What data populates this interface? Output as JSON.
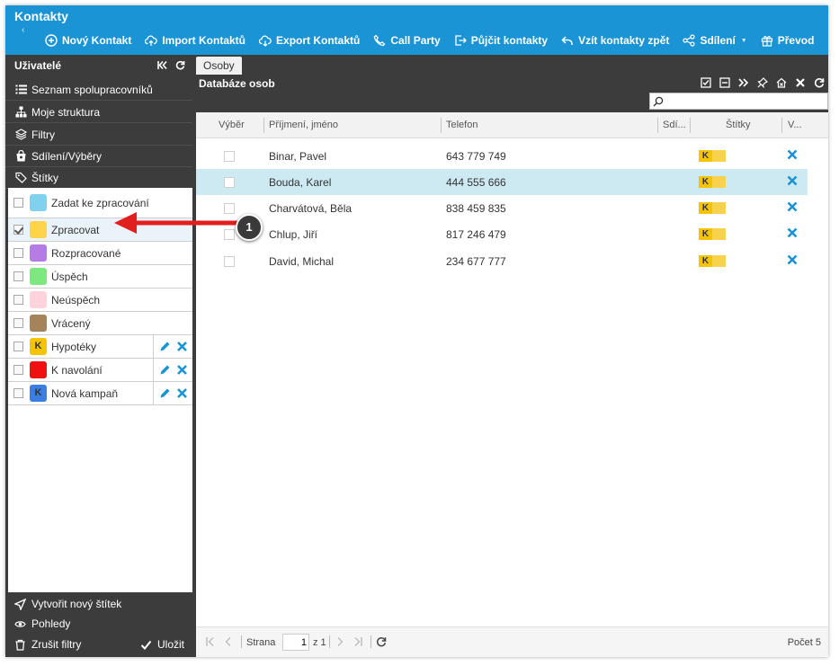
{
  "app": {
    "title": "Kontakty"
  },
  "colors": {
    "appbar": "#1a94d4",
    "sidebar": "#3c3c3c",
    "selected_row": "#cdeaf3",
    "delete_icon": "#1a94d4",
    "callout_arrow": "#e21f1f"
  },
  "toolbar": [
    {
      "label": "Nový Kontakt",
      "icon": "plus-circle-icon"
    },
    {
      "label": "Import Kontaktů",
      "icon": "cloud-upload-icon"
    },
    {
      "label": "Export Kontaktů",
      "icon": "cloud-download-icon"
    },
    {
      "label": "Call Party",
      "icon": "phone-icon"
    },
    {
      "label": "Půjčit kontakty",
      "icon": "share-out-icon"
    },
    {
      "label": "Vzít kontakty zpět",
      "icon": "undo-icon"
    },
    {
      "label": "Sdílení",
      "icon": "share-icon"
    },
    {
      "label": "Převod",
      "icon": "gift-icon"
    }
  ],
  "sidebar": {
    "title": "Uživatelé",
    "nav": [
      {
        "label": "Seznam spolupracovníků",
        "icon": "list-icon"
      },
      {
        "label": "Moje struktura",
        "icon": "hierarchy-icon"
      },
      {
        "label": "Filtry",
        "icon": "layers-icon"
      },
      {
        "label": "Sdílení/Výběry",
        "icon": "bag-icon"
      },
      {
        "label": "Štítky",
        "icon": "tags-icon"
      }
    ],
    "tags": [
      {
        "label": "Zadat ke zpracování",
        "color": "#7fd1ee",
        "letter": "",
        "checked": false,
        "editable": false
      },
      {
        "label": "Zpracovat",
        "color": "#ffd34a",
        "letter": "",
        "checked": true,
        "editable": false
      },
      {
        "label": "Rozpracované",
        "color": "#b57ce6",
        "letter": "",
        "checked": false,
        "editable": false
      },
      {
        "label": "Úspěch",
        "color": "#7de87d",
        "letter": "",
        "checked": false,
        "editable": false
      },
      {
        "label": "Neúspěch",
        "color": "#ffd3dc",
        "letter": "",
        "checked": false,
        "editable": false
      },
      {
        "label": "Vrácený",
        "color": "#a5835b",
        "letter": "",
        "checked": false,
        "editable": false
      },
      {
        "label": "Hypotéky",
        "color": "#f5c400",
        "letter": "K",
        "checked": false,
        "editable": true
      },
      {
        "label": "K navolání",
        "color": "#f01010",
        "letter": "",
        "checked": false,
        "editable": true
      },
      {
        "label": "Nová kampaň",
        "color": "#3b7de0",
        "letter": "K",
        "checked": false,
        "editable": true
      }
    ],
    "footer": {
      "create_tag": "Vytvořit nový štítek",
      "views": "Pohledy",
      "clear_filters": "Zrušit filtry",
      "save": "Uložit"
    }
  },
  "main": {
    "tab": "Osoby",
    "title": "Databáze osob",
    "search_placeholder": "",
    "columns": [
      "Výběr",
      "Příjmení, jméno",
      "Telefon",
      "Sdí...",
      "Štítky",
      "V..."
    ],
    "rows": [
      {
        "name": "Binar, Pavel",
        "phone": "643 779 749",
        "tag": "K",
        "selected": false
      },
      {
        "name": "Bouda, Karel",
        "phone": "444 555 666",
        "tag": "K",
        "selected": true
      },
      {
        "name": "Charvátová, Běla",
        "phone": "838 459 835",
        "tag": "K",
        "selected": false
      },
      {
        "name": "Chlup, Jiří",
        "phone": "817 246 479",
        "tag": "K",
        "selected": false
      },
      {
        "name": "David, Michal",
        "phone": "234 677 777",
        "tag": "K",
        "selected": false
      }
    ],
    "pager": {
      "page_label": "Strana",
      "page": "1",
      "of_label": "z 1",
      "count_label": "Počet 5"
    }
  },
  "callout": {
    "number": "1"
  }
}
